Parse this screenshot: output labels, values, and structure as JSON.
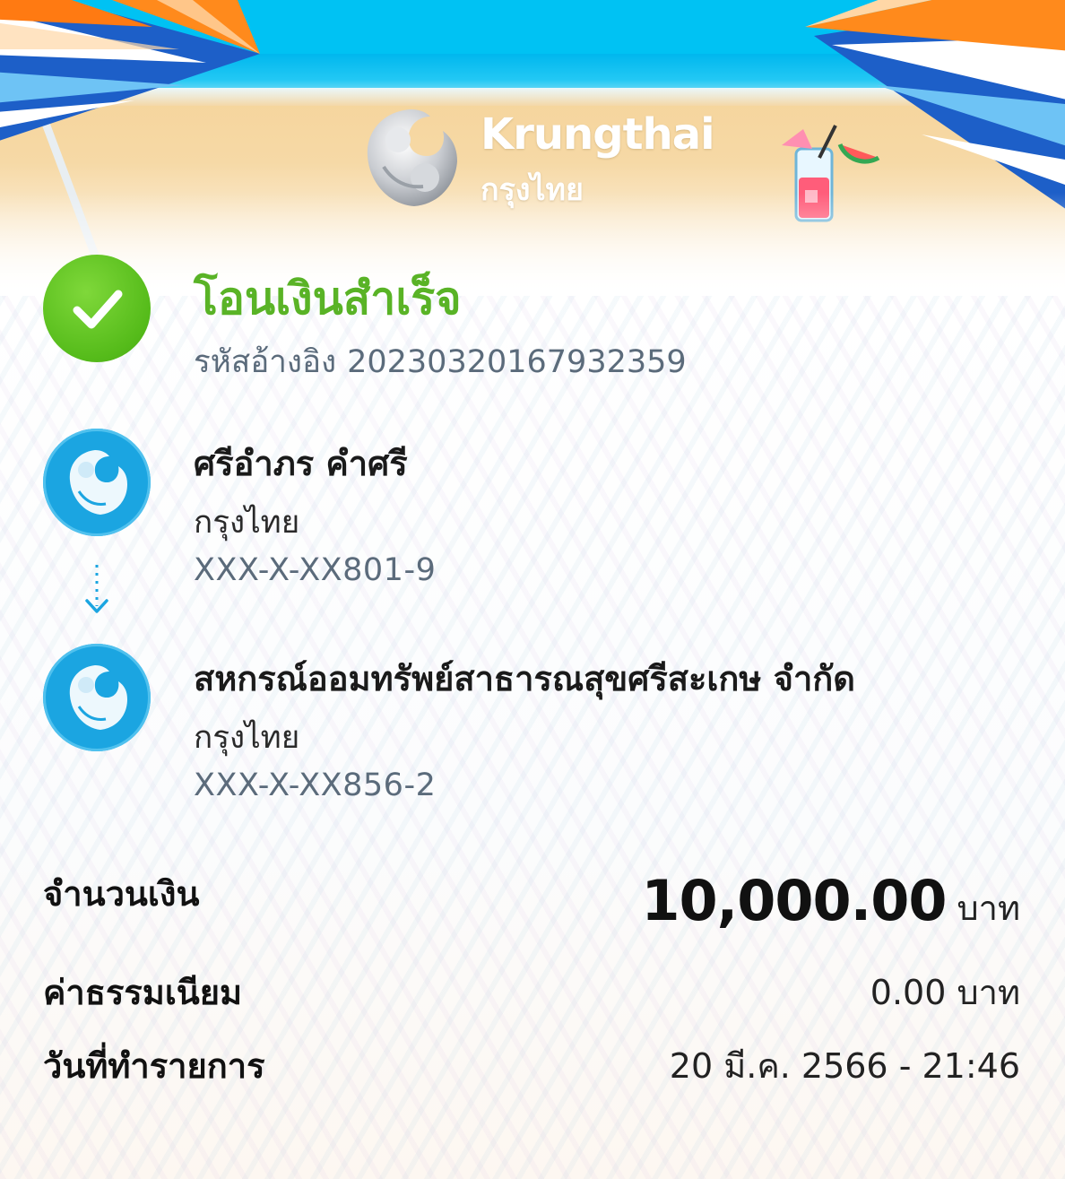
{
  "brand": {
    "name_en": "Krungthai",
    "name_th": "กรุงไทย"
  },
  "status": {
    "title": "โอนเงินสำเร็จ",
    "ref_label": "รหัสอ้างอิง",
    "ref_number": "202303201679323​59"
  },
  "sender": {
    "name": "ศรีอำภร คำศรี",
    "bank": "กรุงไทย",
    "account": "XXX-X-XX801-9"
  },
  "receiver": {
    "name": "สหกรณ์ออมทรัพย์สาธารณสุขศรีสะเกษ จำกัด",
    "bank": "กรุงไทย",
    "account": "XXX-X-XX856-2"
  },
  "details": {
    "amount_label": "จำนวนเงิน",
    "amount_value": "10,000.00",
    "amount_unit": "บาท",
    "fee_label": "ค่าธรรมเนียม",
    "fee_value": "0.00 บาท",
    "date_label": "วันที่ทำรายการ",
    "date_value": "20 มี.ค. 2566 - 21:46"
  },
  "colors": {
    "success": "#59b326",
    "brand_blue": "#1ba5e1",
    "muted": "#5b6b7b"
  },
  "icons": {
    "status": "check-circle-icon",
    "bank": "krungthai-bird-logo",
    "transfer": "dotted-arrow-down-icon"
  }
}
